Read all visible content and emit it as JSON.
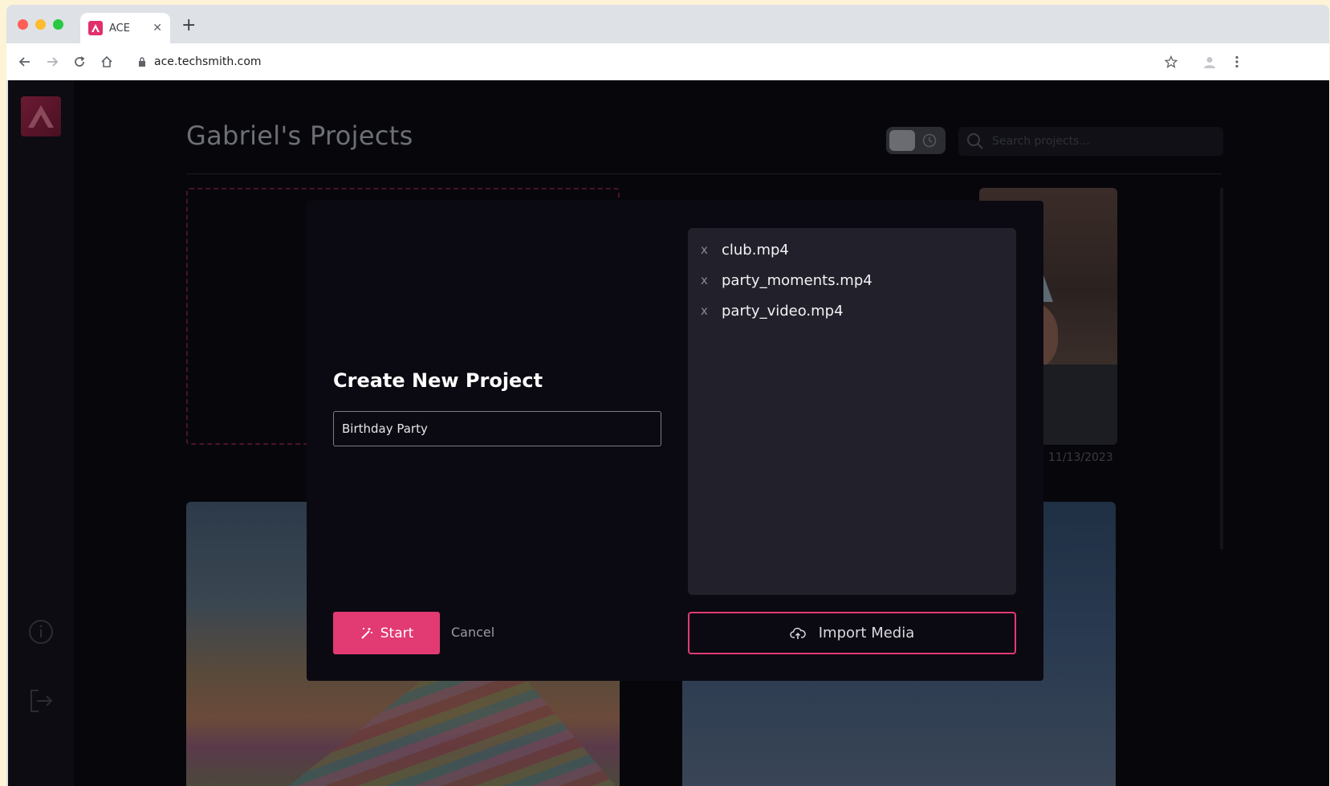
{
  "browser": {
    "tab_title": "ACE",
    "url": "ace.techsmith.com"
  },
  "app": {
    "page_title": "Gabriel's Projects",
    "search_placeholder": "Search projects...",
    "project_date": "11/13/2023"
  },
  "modal": {
    "title": "Create New Project",
    "project_name": "Birthday Party",
    "media_files": [
      {
        "name": "club.mp4",
        "remove_label": "x"
      },
      {
        "name": "party_moments.mp4",
        "remove_label": "x"
      },
      {
        "name": "party_video.mp4",
        "remove_label": "x"
      }
    ],
    "start_label": "Start",
    "cancel_label": "Cancel",
    "import_label": "Import Media"
  },
  "colors": {
    "accent": "#e23a72",
    "modal_bg": "#0b0a12",
    "media_panel_bg": "#22212b"
  }
}
